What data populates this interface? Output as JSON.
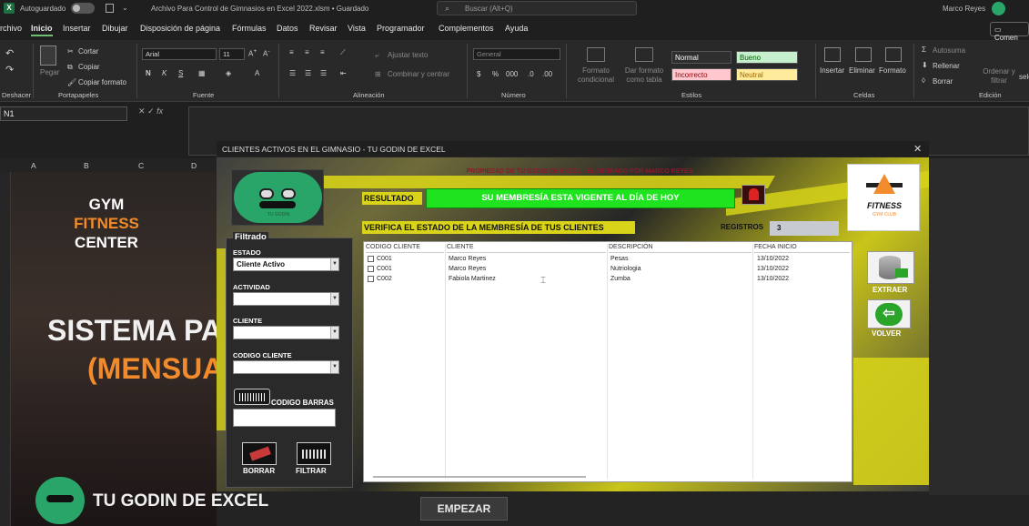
{
  "titlebar": {
    "autosave_label": "Autoguardado",
    "file_title": "Archivo Para Control de Gimnasios en Excel 2022.xlsm • Guardado",
    "search_placeholder": "Buscar (Alt+Q)",
    "user_name": "Marco Reyes"
  },
  "menu": {
    "items": [
      "rchivo",
      "Inicio",
      "Insertar",
      "Dibujar",
      "Disposición de página",
      "Fórmulas",
      "Datos",
      "Revisar",
      "Vista",
      "Programador",
      "Complementos",
      "Ayuda"
    ],
    "active": "Inicio",
    "comment_button": "Comen"
  },
  "ribbon": {
    "groups": {
      "undo": "Deshacer",
      "clipboard": "Portapapeles",
      "font": "Fuente",
      "alignment": "Alineación",
      "number": "Número",
      "styles": "Estilos",
      "cells": "Celdas",
      "editing": "Edición"
    },
    "clipboard": {
      "paste": "Pegar",
      "cut": "Cortar",
      "copy": "Copiar",
      "format_painter": "Copiar formato"
    },
    "font": {
      "name": "Arial",
      "size": "11",
      "bold": "N",
      "italic": "K",
      "underline": "S"
    },
    "alignment": {
      "wrap": "Ajustar texto",
      "merge": "Combinar y centrar"
    },
    "number": {
      "format": "General",
      "currency": "$",
      "percent": "%"
    },
    "styles": {
      "cond_format": "Formato condicional",
      "table_format": "Dar formato como tabla",
      "normal": "Normal",
      "bueno": "Bueno",
      "incorrecto": "Incorrecto",
      "neutral": "Neutral"
    },
    "cells": {
      "insert": "Insertar",
      "delete": "Eliminar",
      "format": "Formato"
    },
    "editing": {
      "autosum": "Autosuma",
      "fill": "Rellenar",
      "clear": "Borrar",
      "sort": "Ordenar y filtrar",
      "select": "selec"
    }
  },
  "formula_bar": {
    "name_box": "N1",
    "fx": "fx"
  },
  "sheet": {
    "columns": [
      "A",
      "B",
      "C",
      "D"
    ],
    "banner": {
      "line1": "GYM",
      "line2": "FITNESS",
      "line3": "CENTER",
      "big": "SISTEMA PA",
      "sub": "(MENSUA",
      "brand": "TU GODIN DE EXCEL"
    },
    "start_button": "EMPEZAR"
  },
  "userform": {
    "title": "CLIENTES ACTIVOS EN EL GIMNASIO - TU GODIN DE EXCEL",
    "owner": "PROPIEDAD DE TU GODIN DE EXCEL - ELABORADO POR MARCO REYES",
    "result_label": "RESULTADO",
    "result_value": "SU MEMBRESÍA ESTA VIGENTE AL DÍA DE HOY",
    "verify_label": "VERIFICA EL ESTADO DE LA MEMBRESÍA DE TUS CLIENTES",
    "records_label": "REGISTROS",
    "records_value": "3",
    "avatar_caption": "TU GODIN",
    "logo": {
      "line1": "FITNESS",
      "line2": "GYM CLUB"
    },
    "filter": {
      "legend": "Filtrado",
      "estado_label": "ESTADO",
      "estado_value": "Cliente Activo",
      "actividad_label": "ACTIVIDAD",
      "actividad_value": "",
      "cliente_label": "CLIENTE",
      "cliente_value": "",
      "codigo_label": "CODIGO CLIENTE",
      "codigo_value": "",
      "barcode_label": "CODIGO BARRAS",
      "barcode_value": "",
      "clear_button": "BORRAR",
      "filter_button": "FILTRAR"
    },
    "table": {
      "headers": [
        "CODIGO CLIENTE",
        "CLIENTE",
        "DESCRIPCIÓN",
        "FECHA INICIO"
      ],
      "rows": [
        [
          "C001",
          "Marco Reyes",
          "Pesas",
          "13/10/2022"
        ],
        [
          "C001",
          "Marco Reyes",
          "Nutriologia",
          "13/10/2022"
        ],
        [
          "C002",
          "Fabiola Martinez",
          "Zumba",
          "13/10/2022"
        ]
      ]
    },
    "side_buttons": {
      "extract": "EXTRAER",
      "back": "VOLVER"
    }
  }
}
